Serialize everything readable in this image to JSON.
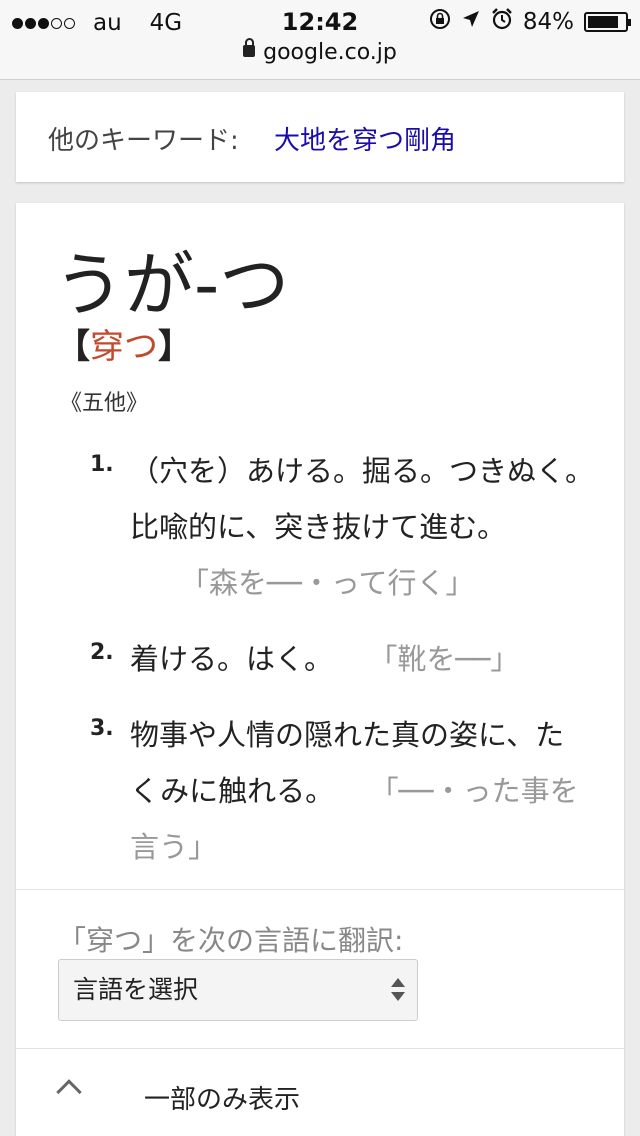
{
  "status": {
    "carrier": "au",
    "network": "4G",
    "time": "12:42",
    "battery": "84%",
    "battery_level": 0.84,
    "url": "google.co.jp"
  },
  "keywords": {
    "label": "他のキーワード:",
    "link": "大地を穿つ剛角"
  },
  "entry": {
    "headword": "うが-つ",
    "bracket_open": "【",
    "kanji": "穿つ",
    "bracket_close": "】",
    "pos": "《五他》",
    "definitions": [
      {
        "num": "1.",
        "text": "（穴を）あける。掘る。つきぬく。比喩的に、突き抜けて進む。",
        "example": "「森を──・って行く」"
      },
      {
        "num": "2.",
        "text": "着ける。はく。",
        "example": "「靴を──」"
      },
      {
        "num": "3.",
        "text": "物事や人情の隠れた真の姿に、たくみに触れる。",
        "example": "「──・った事を言う」"
      }
    ]
  },
  "translate": {
    "label": "「穿つ」を次の言語に翻訳:",
    "select_value": "言語を選択"
  },
  "collapse": {
    "label": "一部のみ表示"
  },
  "colors": {
    "link": "#1a0dab",
    "kanji": "#c24a2c",
    "example": "#999999"
  }
}
